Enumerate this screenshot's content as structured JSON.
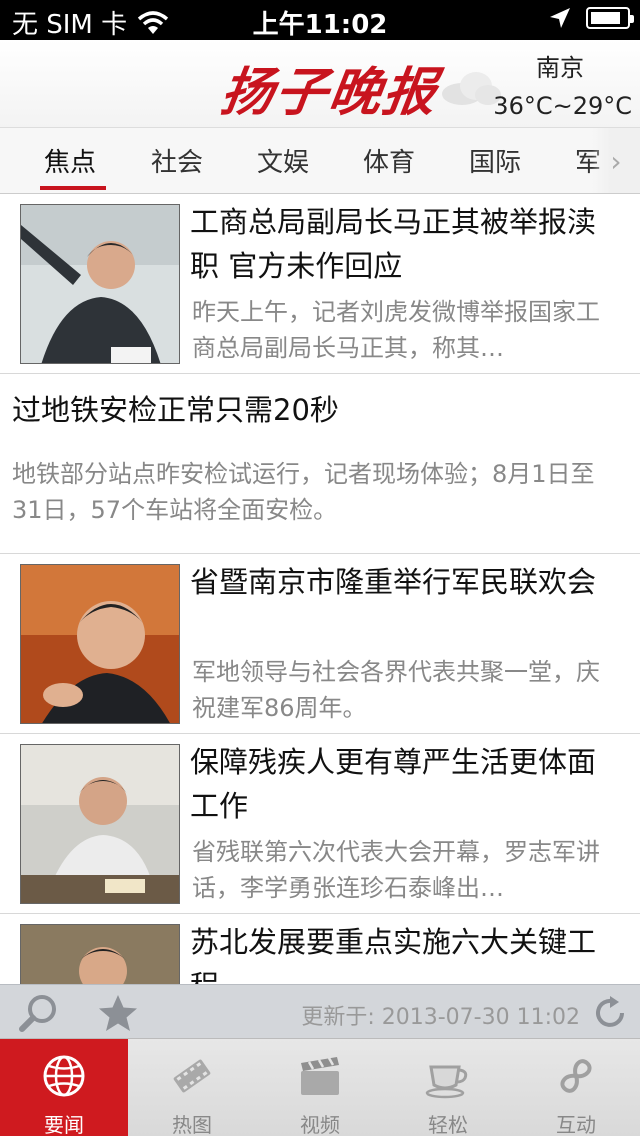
{
  "status_bar": {
    "carrier": "无 SIM 卡",
    "time": "上午11:02",
    "battery_level": 0.85
  },
  "header": {
    "logo_text": "扬子晚报",
    "weather_icon": "cloud-icon",
    "city": "南京",
    "temperature": "36°C~29°C"
  },
  "tabs": [
    {
      "label": "焦点",
      "active": true
    },
    {
      "label": "社会"
    },
    {
      "label": "文娱"
    },
    {
      "label": "体育"
    },
    {
      "label": "国际"
    },
    {
      "label": "军"
    }
  ],
  "news": [
    {
      "title": "工商总局副局长马正其被举报渎职 官方未作回应",
      "summary": "昨天上午，记者刘虎发微博举报国家工商总局副局长马正其，称其…"
    },
    {
      "title": "过地铁安检正常只需20秒",
      "summary": "地铁部分站点昨安检试运行，记者现场体验；8月1日至31日，57个车站将全面安检。"
    },
    {
      "title": "省暨南京市隆重举行军民联欢会",
      "summary": "军地领导与社会各界代表共聚一堂，庆祝建军86周年。"
    },
    {
      "title": "保障残疾人更有尊严生活更体面工作",
      "summary": "省残联第六次代表大会开幕，罗志军讲话，李学勇张连珍石泰峰出…"
    },
    {
      "title": "苏北发展要重点实施六大关键工程",
      "summary": ""
    }
  ],
  "update_bar": {
    "update_text": "更新于: 2013-07-30 11:02"
  },
  "bottom_nav": [
    {
      "label": "要闻",
      "icon": "globe-icon",
      "active": true
    },
    {
      "label": "热图",
      "icon": "film-icon"
    },
    {
      "label": "视频",
      "icon": "clapperboard-icon"
    },
    {
      "label": "轻松",
      "icon": "coffee-cup-icon"
    },
    {
      "label": "互动",
      "icon": "infinity-icon"
    }
  ],
  "colors": {
    "brand_red": "#c8141e",
    "nav_active": "#cf1a1f",
    "summary_gray": "#888888"
  }
}
